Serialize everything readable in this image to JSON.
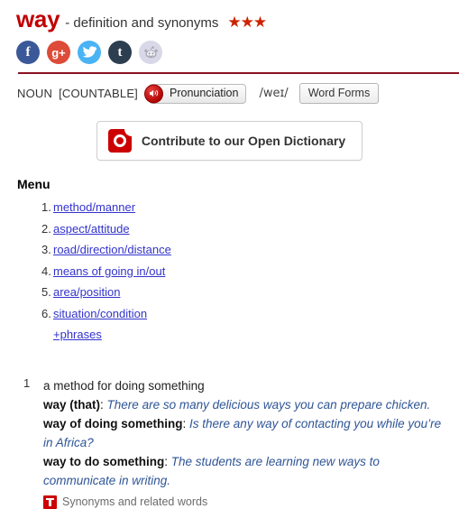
{
  "header": {
    "headword": "way",
    "suffix": "- definition and synonyms",
    "stars": "★★★",
    "stars_icon": "three-star-rating"
  },
  "social": {
    "items": [
      {
        "name": "facebook",
        "glyph": "f",
        "color": "#3b5998"
      },
      {
        "name": "google-plus",
        "glyph": "g+",
        "color": "#dd4b39"
      },
      {
        "name": "twitter",
        "glyph": "➤",
        "color": "#4ab3f4"
      },
      {
        "name": "tumblr",
        "glyph": "t",
        "color": "#2c3e50"
      },
      {
        "name": "reddit",
        "glyph": "●",
        "color": "#d8d8e8"
      }
    ]
  },
  "pos": {
    "part_of_speech": "NOUN",
    "grammar": "[COUNTABLE]",
    "pronunciation_label": "Pronunciation",
    "speaker_icon": "speaker-icon",
    "phonetic": "/weɪ/",
    "word_forms_label": "Word Forms"
  },
  "contribute": {
    "label": "Contribute to our Open Dictionary",
    "logo_icon": "macmillan-logo-icon"
  },
  "menu": {
    "title": "Menu",
    "items": [
      {
        "num": "1.",
        "label": "method/manner"
      },
      {
        "num": "2.",
        "label": "aspect/attitude"
      },
      {
        "num": "3.",
        "label": "road/direction/distance"
      },
      {
        "num": "4.",
        "label": "means of going in/out"
      },
      {
        "num": "5.",
        "label": "area/position"
      },
      {
        "num": "6.",
        "label": "situation/condition"
      }
    ],
    "phrases_label": "+phrases"
  },
  "sense": {
    "number": "1",
    "definition": "a method for doing something",
    "examples": [
      {
        "pattern": "way (that)",
        "colon": ":",
        "text": "There are so many delicious ways you can prepare chicken."
      },
      {
        "pattern": "way of doing something",
        "colon": ":",
        "text": "Is there any way of contacting you while you’re in Africa?"
      },
      {
        "pattern": "way to do something",
        "colon": ":",
        "text": "The students are learning new ways to communicate in writing."
      }
    ],
    "thesaurus_label": "Synonyms and related words",
    "thesaurus_icon": "thesaurus-icon"
  }
}
